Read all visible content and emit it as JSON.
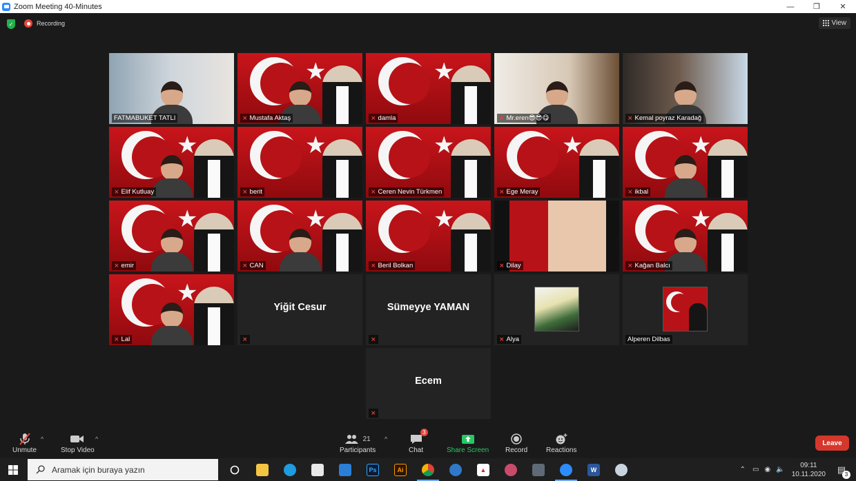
{
  "window": {
    "title": "Zoom Meeting 40-Minutes",
    "minimize": "—",
    "restore": "❐",
    "close": "✕"
  },
  "meeting": {
    "recording_label": "Recording",
    "view_label": "View"
  },
  "participants": [
    {
      "name": "FATMABUKET TATLI",
      "style": "room",
      "muted": false,
      "active": true
    },
    {
      "name": "Mustafa Aktaş",
      "style": "flag-person",
      "muted": true
    },
    {
      "name": "damla",
      "style": "flag",
      "muted": true
    },
    {
      "name": "Mr.eren😎😎😋",
      "style": "room2",
      "muted": true
    },
    {
      "name": "Kemal poyraz Karadağ",
      "style": "room3",
      "muted": true
    },
    {
      "name": "Elif Kutluay",
      "style": "flag-person",
      "muted": true
    },
    {
      "name": "berit",
      "style": "flag",
      "muted": true
    },
    {
      "name": "Ceren Nevin Türkmen",
      "style": "flag",
      "muted": true
    },
    {
      "name": "Ege Meray",
      "style": "flag",
      "muted": true
    },
    {
      "name": "ikbal",
      "style": "flag-person",
      "muted": true
    },
    {
      "name": "emir",
      "style": "flag-person",
      "muted": true
    },
    {
      "name": "CAN",
      "style": "flag-person",
      "muted": true
    },
    {
      "name": "Beril Bolkan",
      "style": "flag",
      "muted": true
    },
    {
      "name": "Dilay",
      "style": "dark",
      "muted": true
    },
    {
      "name": "Kağan Balcı",
      "style": "flag-person",
      "muted": true
    },
    {
      "name": "Lal",
      "style": "flag-person",
      "muted": true
    },
    {
      "name": "",
      "big": "Yiğit Cesur",
      "style": "blank",
      "muted": true
    },
    {
      "name": "",
      "big": "Sümeyye YAMAN",
      "style": "blank",
      "muted": true
    },
    {
      "name": "Alya",
      "style": "blank-thumb",
      "thumb": "anime",
      "muted": true
    },
    {
      "name": "Alperen Dilbas",
      "style": "blank-thumb",
      "thumb": "flag",
      "muted": false
    },
    {
      "name": "",
      "big": "Ecem",
      "style": "blank",
      "muted": true
    }
  ],
  "toolbar": {
    "unmute": "Unmute",
    "stop_video": "Stop Video",
    "participants": "Participants",
    "participants_count": "21",
    "chat": "Chat",
    "chat_badge": "3",
    "share_screen": "Share Screen",
    "record": "Record",
    "reactions": "Reactions",
    "leave": "Leave"
  },
  "taskbar": {
    "search_placeholder": "Aramak için buraya yazın",
    "time": "09:11",
    "date": "10.11.2020",
    "notifications": "3"
  }
}
